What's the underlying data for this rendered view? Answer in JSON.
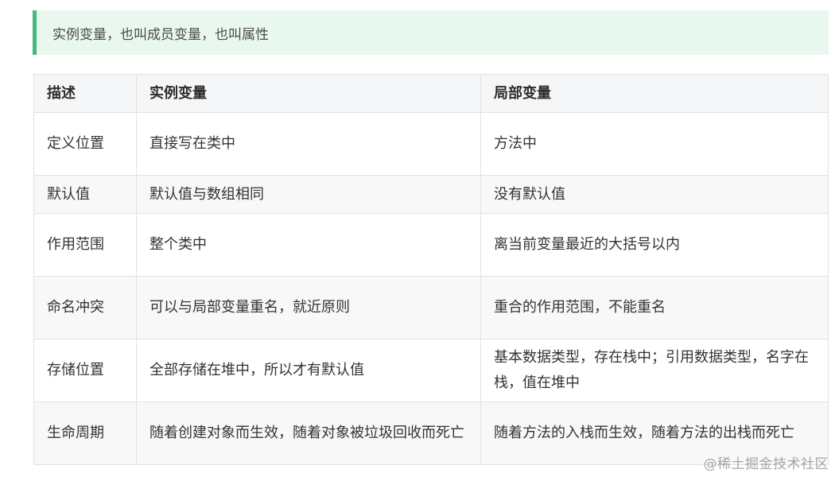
{
  "tip": {
    "text": "实例变量，也叫成员变量，也叫属性"
  },
  "table": {
    "headers": [
      "描述",
      "实例变量",
      "局部变量"
    ],
    "rows": [
      [
        "定义位置",
        "直接写在类中",
        "方法中"
      ],
      [
        "默认值",
        "默认值与数组相同",
        "没有默认值"
      ],
      [
        "作用范围",
        "整个类中",
        "离当前变量最近的大括号以内"
      ],
      [
        "命名冲突",
        "可以与局部变量重名，就近原则",
        "重合的作用范围，不能重名"
      ],
      [
        "存储位置",
        "全部存储在堆中，所以才有默认值",
        "基本数据类型，存在栈中；引用数据类型，名字在栈，值在堆中"
      ],
      [
        "生命周期",
        "随着创建对象而生效，随着对象被垃圾回收而死亡",
        "随着方法的入栈而生效，随着方法的出栈而死亡"
      ]
    ]
  },
  "watermark": {
    "text": "@稀土掘金技术社区"
  },
  "colors": {
    "tip_background": "#e9f8ee",
    "tip_border": "#42b983",
    "header_background": "#f5f6f7",
    "row_alt_background": "#f8f8f8",
    "border": "#e2e2e2"
  }
}
